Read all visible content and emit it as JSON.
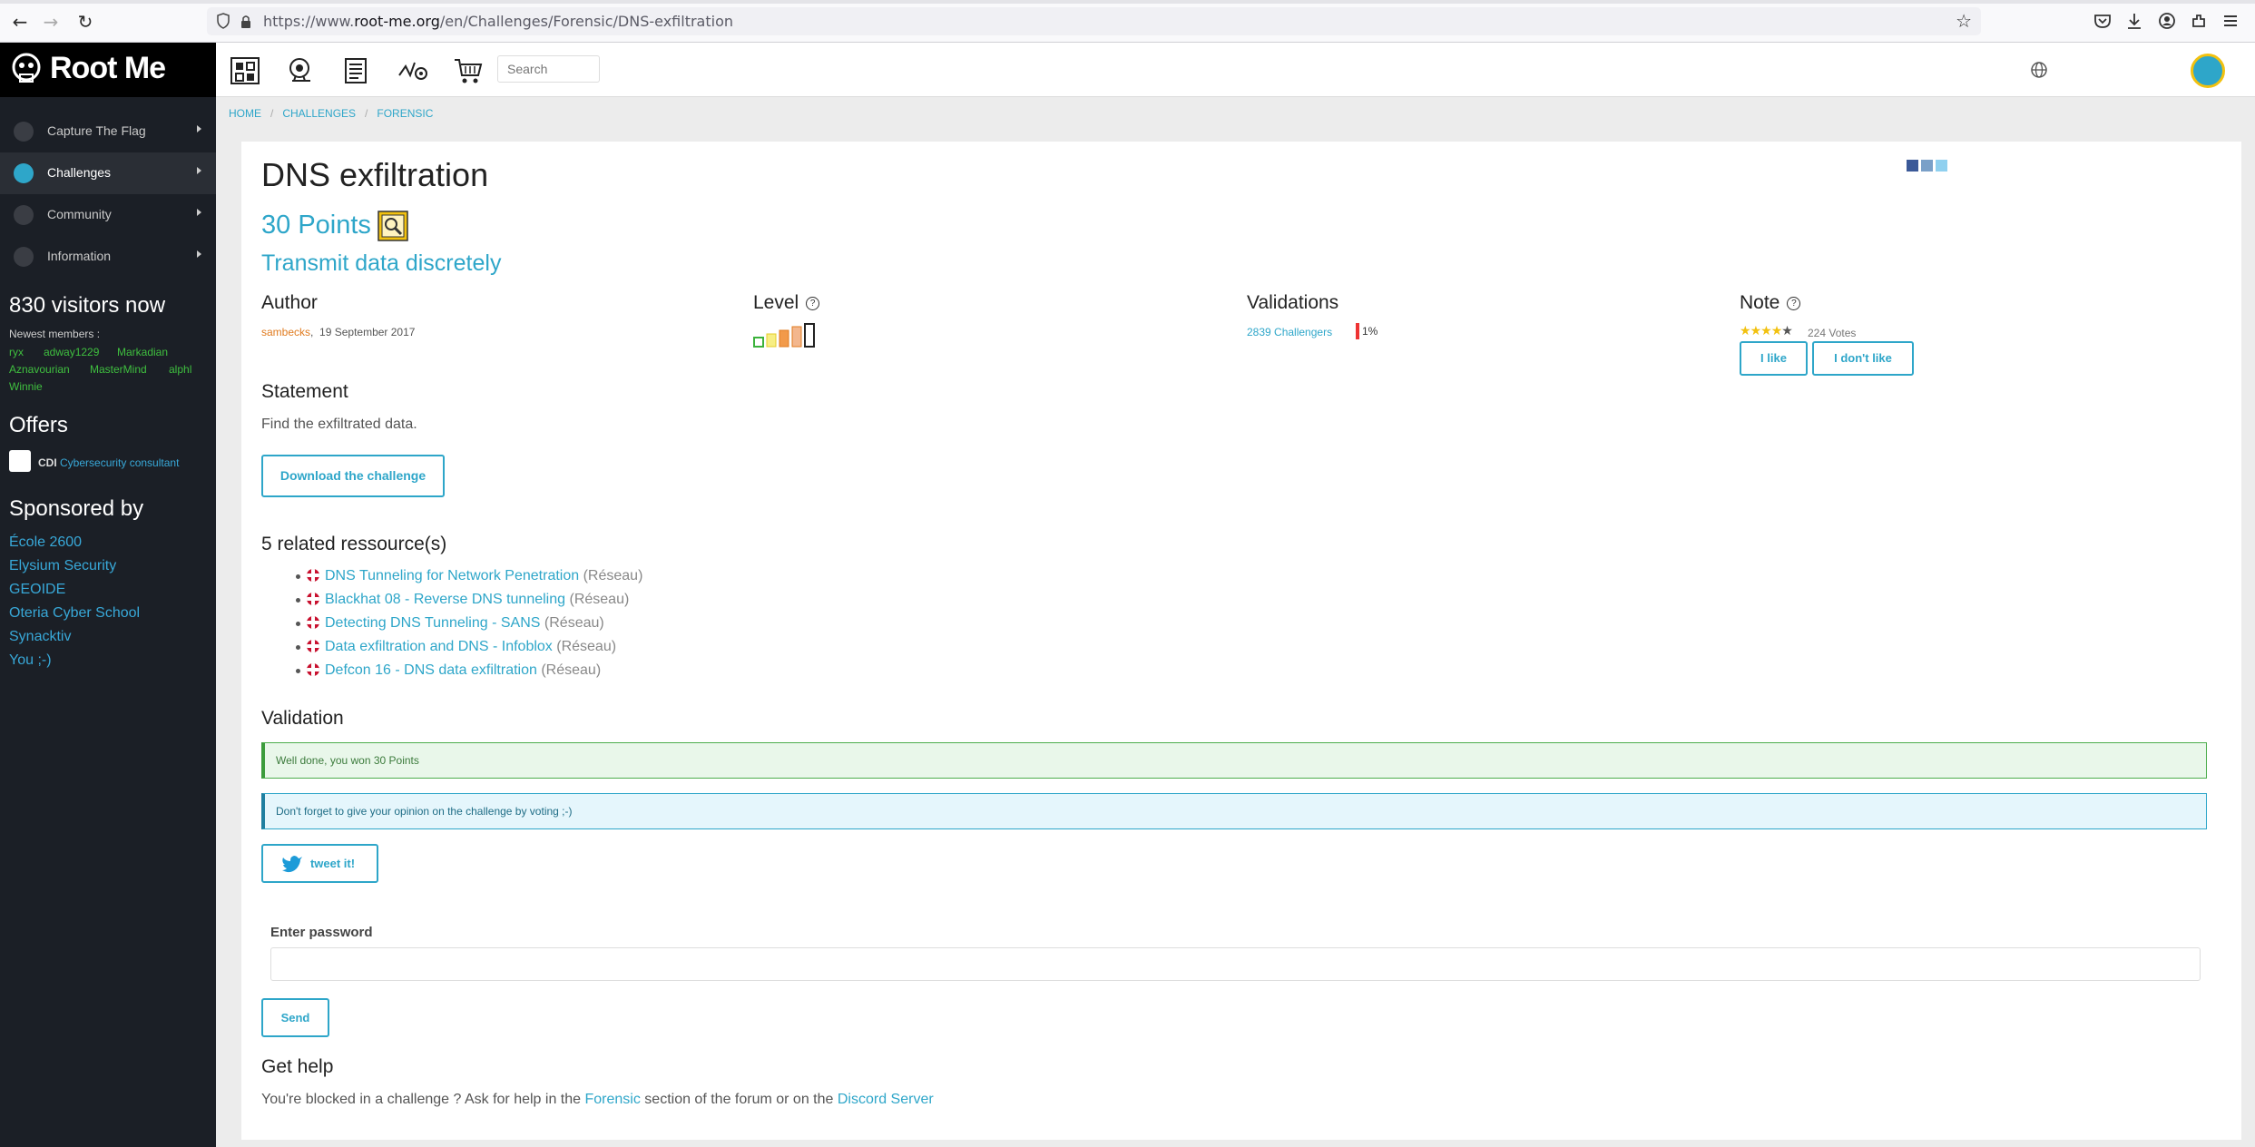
{
  "browser": {
    "url_prefix": "https://www.",
    "url_domain": "root-me.org",
    "url_path": "/en/Challenges/Forensic/DNS-exfiltration"
  },
  "sidebar": {
    "logo": "Root Me",
    "items": [
      {
        "label": "Capture The Flag"
      },
      {
        "label": "Challenges"
      },
      {
        "label": "Community"
      },
      {
        "label": "Information"
      }
    ],
    "visitors": "830 visitors now",
    "newest_label": "Newest members :",
    "members": [
      "ryx",
      "adway1229",
      "Markadian",
      "Aznavourian",
      "MasterMind",
      "alphl",
      "Winnie"
    ],
    "offers_title": "Offers",
    "offer_tag": "CDI",
    "offer_text": "Cybersecurity consultant",
    "sponsored_title": "Sponsored by",
    "sponsors": [
      "École 2600",
      "Elysium Security",
      "GEOIDE",
      "Oteria Cyber School",
      "Synacktiv",
      "You ;-)"
    ]
  },
  "search": {
    "placeholder": "Search"
  },
  "breadcrumb": [
    "HOME",
    "CHALLENGES",
    "FORENSIC"
  ],
  "challenge": {
    "title": "DNS exfiltration",
    "points": "30 Points",
    "subtitle": "Transmit data discretely",
    "author_h": "Author",
    "author": "sambecks",
    "date": "19 September 2017",
    "level_h": "Level",
    "level": 1,
    "level_max": 5,
    "validations_h": "Validations",
    "challengers": "2839 Challengers",
    "percent": "1%",
    "note_h": "Note",
    "rating": 4,
    "rating_max": 5,
    "votes": "224 Votes",
    "like": "I like",
    "dislike": "I don't like",
    "statement_h": "Statement",
    "statement": "Find the exfiltrated data.",
    "download": "Download the challenge",
    "resources_h": "5 related ressource(s)",
    "resources": [
      {
        "title": "DNS Tunneling for Network Penetration",
        "cat": "(Réseau)"
      },
      {
        "title": "Blackhat 08 - Reverse DNS tunneling",
        "cat": "(Réseau)"
      },
      {
        "title": "Detecting DNS Tunneling - SANS",
        "cat": "(Réseau)"
      },
      {
        "title": "Data exfiltration and DNS - Infoblox",
        "cat": "(Réseau)"
      },
      {
        "title": "Defcon 16 - DNS data exfiltration",
        "cat": "(Réseau)"
      }
    ],
    "validation_h": "Validation",
    "success_msg": "Well done, you won 30 Points",
    "info_msg": "Don't forget to give your opinion on the challenge by voting ;-)",
    "tweet": "tweet it!",
    "password_label": "Enter password",
    "send": "Send",
    "help_h": "Get help",
    "help_pre": "You're blocked in a challenge ? Ask for help in the ",
    "help_link1": "Forensic",
    "help_mid": " section of the forum or on the ",
    "help_link2": "Discord Server"
  },
  "colors": {
    "accent": "#2ea6c9",
    "sidebar": "#1b1f26",
    "author": "#e07b1f",
    "success": "#3c9c3c"
  }
}
